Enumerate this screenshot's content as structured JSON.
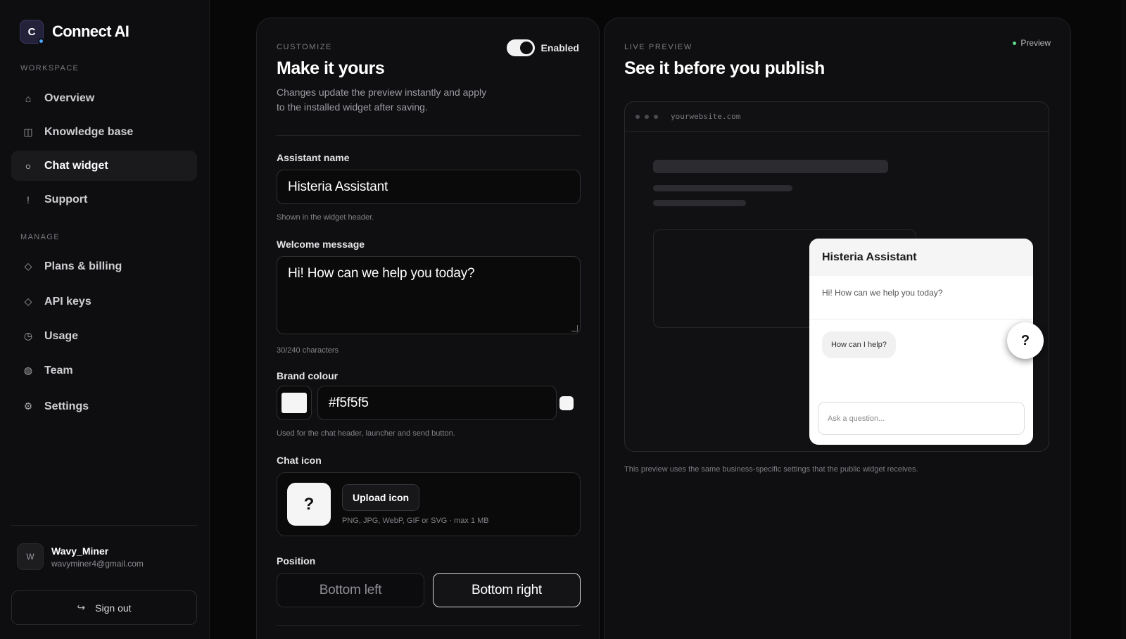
{
  "brand": {
    "logo_letter": "C",
    "name": "Connect AI"
  },
  "sidebar": {
    "workspace_label": "WORKSPACE",
    "manage_label": "MANAGE",
    "workspace_items": [
      {
        "icon": "home-icon",
        "glyph": "⌂",
        "label": "Overview"
      },
      {
        "icon": "book-icon",
        "glyph": "◫",
        "label": "Knowledge base"
      },
      {
        "icon": "chat-icon",
        "glyph": "○",
        "label": "Chat widget",
        "active": true
      },
      {
        "icon": "alert-icon",
        "glyph": "!",
        "label": "Support"
      }
    ],
    "manage_items": [
      {
        "icon": "diamond-icon",
        "glyph": "◇",
        "label": "Plans & billing"
      },
      {
        "icon": "key-icon",
        "glyph": "◇",
        "label": "API keys"
      },
      {
        "icon": "chart-icon",
        "glyph": "◷",
        "label": "Usage"
      },
      {
        "icon": "team-icon",
        "glyph": "◍",
        "label": "Team"
      },
      {
        "icon": "gear-icon",
        "glyph": "⚙",
        "label": "Settings"
      }
    ],
    "user": {
      "initial": "W",
      "name": "Wavy_Miner",
      "email": "wavyminer4@gmail.com"
    },
    "signout_label": "Sign out",
    "signout_glyph": "↪"
  },
  "customize": {
    "eyebrow": "CUSTOMIZE",
    "title": "Make it yours",
    "description": "Changes update the preview instantly and apply to the installed widget after saving.",
    "toggle_label": "Enabled",
    "assistant_name_label": "Assistant name",
    "assistant_name_value": "Histeria Assistant",
    "assistant_name_hint": "Shown in the widget header.",
    "welcome_label": "Welcome message",
    "welcome_value": "Hi! How can we help you today?",
    "welcome_count": "30/240 characters",
    "brand_colour_label": "Brand colour",
    "brand_colour_value": "#f5f5f5",
    "brand_colour_display": "#f5f5f5",
    "brand_colour_hex": "#f5f5f5",
    "brand_colour_hint": "Used for the chat header, launcher and send button.",
    "chat_icon_label": "Chat icon",
    "chat_icon_glyph": "?",
    "upload_label": "Upload icon",
    "upload_hint": "PNG, JPG, WebP, GIF or SVG · max 1 MB",
    "position_label": "Position",
    "position_options": [
      "Bottom left",
      "Bottom right"
    ],
    "position_selected": "Bottom right"
  },
  "preview": {
    "eyebrow": "LIVE PREVIEW",
    "title": "See it before you publish",
    "badge": "Preview",
    "url": "yourwebsite.com",
    "widget_title": "Histeria Assistant",
    "widget_welcome": "Hi! How can we help you today?",
    "widget_chip": "How can I help?",
    "widget_placeholder": "Ask a question...",
    "launcher_glyph": "?",
    "footnote": "This preview uses the same business-specific settings that the public widget receives."
  }
}
